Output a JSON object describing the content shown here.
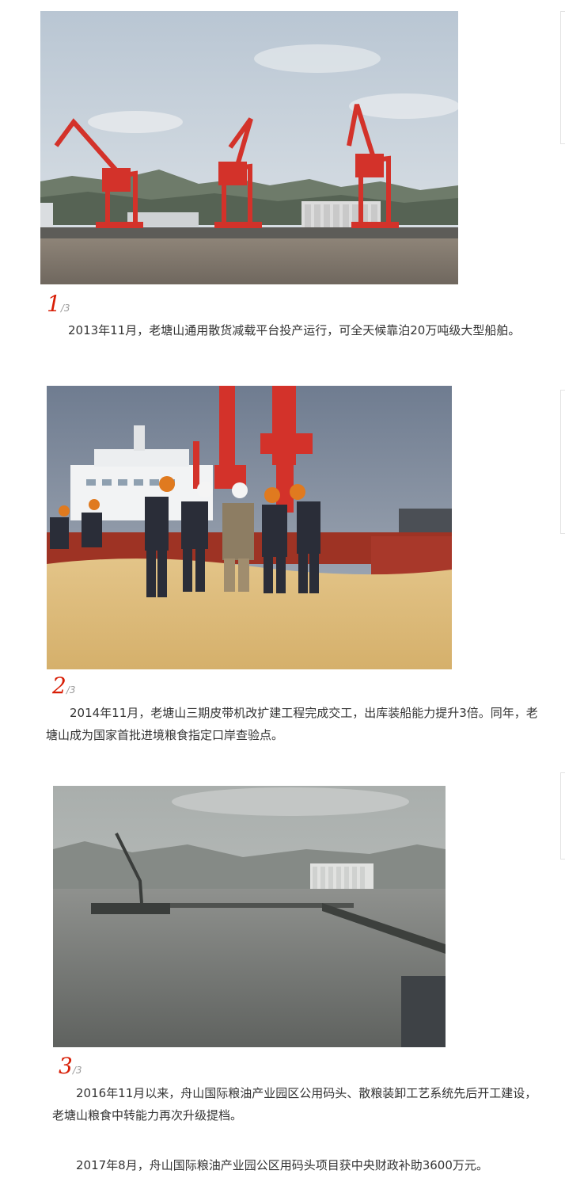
{
  "slides": [
    {
      "number": "1",
      "total": "/3",
      "photo": "harbor-cranes-photo",
      "caption": "2013年11月，老塘山通用散货减载平台投产运行，可全天候靠泊20万吨级大型船舶。"
    },
    {
      "number": "2",
      "total": "/3",
      "photo": "grain-hold-inspection-photo",
      "caption": "2014年11月，老塘山三期皮带机改扩建工程完成交工，出库装船能力提升3倍。同年，老塘山成为国家首批进境粮食指定口岸查验点。"
    },
    {
      "number": "3",
      "total": "/3",
      "photo": "grain-terminal-pier-photo",
      "caption": "2016年11月以来，舟山国际粮油产业园区公用码头、散粮装卸工艺系统先后开工建设，老塘山粮食中转能力再次升级提档。"
    }
  ],
  "extra_paragraph": "2017年8月，舟山国际粮油产业园公区用码头项目获中央财政补助3600万元。",
  "colors": {
    "counter_accent": "#d81e06",
    "crane_red": "#d3322a"
  }
}
